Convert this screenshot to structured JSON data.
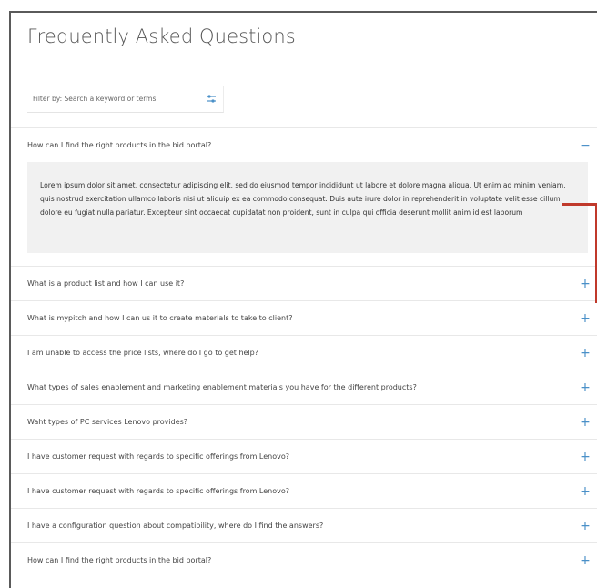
{
  "page": {
    "title": "Frequently Asked Questions"
  },
  "filter": {
    "placeholder": "Filter by: Search a keyword or terms",
    "icon": "sliders-icon"
  },
  "faq": {
    "expanded_index": 0,
    "expanded_toggle": "−",
    "collapsed_toggle": "+",
    "items": [
      {
        "question": "How can I find the right products in the bid portal?",
        "answer": "Lorem ipsum dolor sit amet, consectetur adipiscing elit, sed do eiusmod tempor incididunt ut labore et dolore magna aliqua. Ut enim ad minim veniam, quis nostrud exercitation ullamco laboris nisi ut aliquip ex ea commodo consequat. Duis aute irure dolor in reprehenderit in voluptate velit esse cillum dolore eu fugiat nulla pariatur. Excepteur sint occaecat cupidatat non proident, sunt in culpa qui officia deserunt mollit anim id est laborum"
      },
      {
        "question": "What is a product list and how I can use it?"
      },
      {
        "question": "What is mypitch and how I can us it to create materials to take to client?"
      },
      {
        "question": "I am unable to access the price lists, where do I go to get help?"
      },
      {
        "question": "What types of sales enablement and marketing enablement materials you have for the different products?"
      },
      {
        "question": "Waht types of PC services Lenovo provides?"
      },
      {
        "question": "I have customer request with regards to specific offerings from Lenovo?"
      },
      {
        "question": "I have customer request with regards to specific offerings from Lenovo?"
      },
      {
        "question": "I have a configuration question about compatibility, where do I find the answers?"
      },
      {
        "question": "How can I find the right products in the bid portal?"
      }
    ]
  },
  "colors": {
    "accent": "#4a90c8",
    "annotation": "#c0392b"
  }
}
